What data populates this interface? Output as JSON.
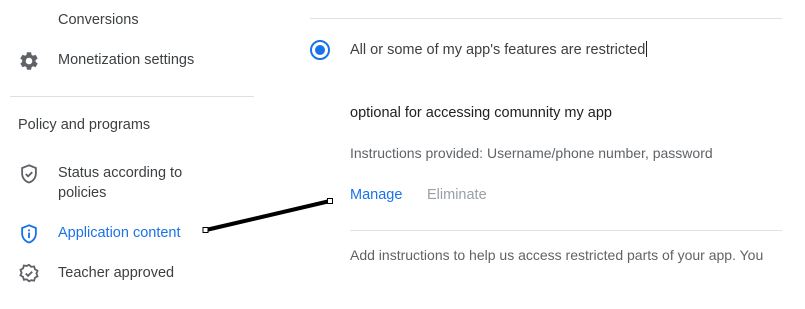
{
  "sidebar": {
    "items_top": [
      {
        "label": "Conversions",
        "icon": "none"
      },
      {
        "label": "Monetization settings",
        "icon": "gear-icon"
      }
    ],
    "section_title": "Policy and programs",
    "items_policy": [
      {
        "label": "Status according to policies",
        "icon": "shield-check-icon"
      },
      {
        "label": "Application content",
        "icon": "shield-info-icon",
        "active": true
      },
      {
        "label": "Teacher approved",
        "icon": "badge-check-icon"
      }
    ]
  },
  "main": {
    "restriction_option": {
      "label": "All or some of my app's features are restricted",
      "selected": true
    },
    "credential": {
      "title": "optional for accessing comunnity my app",
      "description": "Instructions provided: Username/phone number, password",
      "manage_label": "Manage",
      "eliminate_label": "Eliminate"
    },
    "help_text": "Add instructions to help us access restricted parts of your app. You"
  },
  "colors": {
    "accent": "#1a73e8",
    "text_primary": "#202124",
    "text_secondary": "#5f6368",
    "disabled": "#9aa0a6",
    "divider": "#e0e0e0"
  }
}
